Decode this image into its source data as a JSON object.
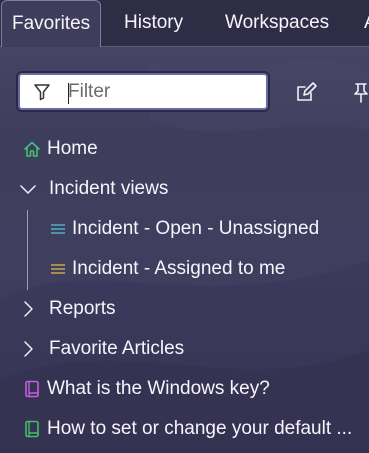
{
  "tabs": [
    {
      "label": "Favorites",
      "active": true
    },
    {
      "label": "History",
      "active": false
    },
    {
      "label": "Workspaces",
      "active": false
    },
    {
      "label": "A",
      "active": false
    }
  ],
  "filter": {
    "placeholder": "Filter",
    "value": ""
  },
  "toolbar": {
    "edit_icon": "edit-icon",
    "pin_icon": "pin-icon"
  },
  "tree": {
    "home": {
      "label": "Home",
      "icon": "home-icon"
    },
    "incident_views": {
      "label": "Incident views",
      "expanded": true,
      "children": [
        {
          "label": "Incident - Open - Unassigned",
          "icon": "list-icon",
          "icon_color": "#4fb0c6"
        },
        {
          "label": "Incident - Assigned to me",
          "icon": "list-icon",
          "icon_color": "#c9a646"
        }
      ]
    },
    "reports": {
      "label": "Reports",
      "expanded": false
    },
    "favorite_articles": {
      "label": "Favorite Articles",
      "expanded": false
    },
    "articles": [
      {
        "label": "What is the Windows key?",
        "icon": "book-icon",
        "icon_color": "#c160e0"
      },
      {
        "label": "How to set or change your default ...",
        "icon": "book-icon",
        "icon_color": "#3fbf6a"
      }
    ]
  },
  "colors": {
    "home_icon": "#43c07a",
    "tab_bar": "#2f2d46",
    "panel": "#403e5e"
  }
}
